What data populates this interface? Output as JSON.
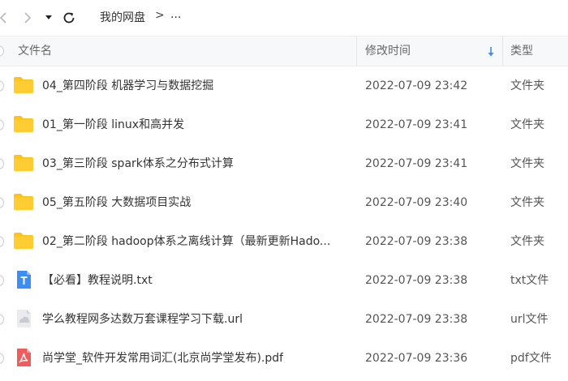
{
  "breadcrumb": {
    "root": "我的网盘",
    "separator": ">",
    "more": "..."
  },
  "header": {
    "name": "文件名",
    "time": "修改时间",
    "type": "类型"
  },
  "colors": {
    "folder": "#ffc31a",
    "txt": "#3a8ef6",
    "pdf": "#f05c5c",
    "url": "#c7cbd1",
    "sort_arrow": "#3a8ef6"
  },
  "files": [
    {
      "name": "04_第四阶段  机器学习与数据挖掘",
      "time": "2022-07-09 23:42",
      "type": "文件夹",
      "icon": "folder-icon"
    },
    {
      "name": "01_第一阶段  linux和高并发",
      "time": "2022-07-09 23:41",
      "type": "文件夹",
      "icon": "folder-icon"
    },
    {
      "name": "03_第三阶段  spark体系之分布式计算",
      "time": "2022-07-09 23:41",
      "type": "文件夹",
      "icon": "folder-icon"
    },
    {
      "name": "05_第五阶段  大数据项目实战",
      "time": "2022-07-09 23:40",
      "type": "文件夹",
      "icon": "folder-icon"
    },
    {
      "name": "02_第二阶段  hadoop体系之离线计算（最新更新Hado...",
      "time": "2022-07-09 23:38",
      "type": "文件夹",
      "icon": "folder-icon"
    },
    {
      "name": "【必看】教程说明.txt",
      "time": "2022-07-09 23:38",
      "type": "txt文件",
      "icon": "txt-file-icon"
    },
    {
      "name": "学么教程网多达数万套课程学习下载.url",
      "time": "2022-07-09 23:38",
      "type": "url文件",
      "icon": "url-file-icon"
    },
    {
      "name": "尚学堂_软件开发常用词汇(北京尚学堂发布).pdf",
      "time": "2022-07-09 23:36",
      "type": "pdf文件",
      "icon": "pdf-file-icon"
    }
  ]
}
